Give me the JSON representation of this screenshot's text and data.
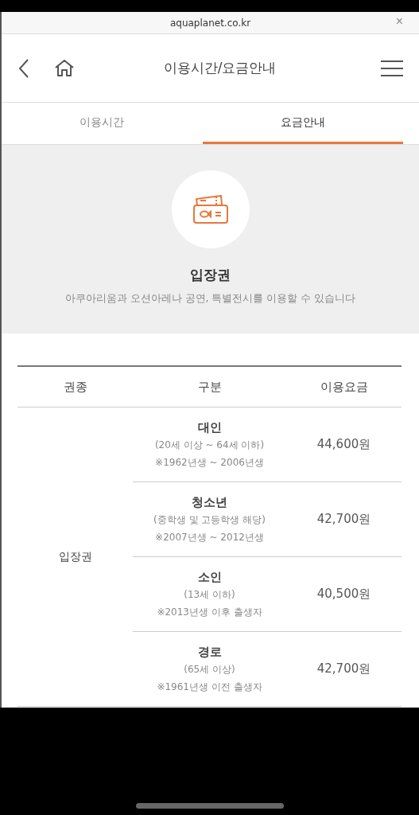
{
  "browser_bar": {
    "url": "aquaplanet.co.kr",
    "close": "×"
  },
  "header": {
    "title": "이용시간/요금안내"
  },
  "tabs": [
    {
      "label": "이용시간",
      "selected": false
    },
    {
      "label": "요금안내",
      "selected": true
    }
  ],
  "intro": {
    "title": "입장권",
    "description": "아쿠아리움과 오션아레나 공연, 특별전시를 이용할 수 있습니다"
  },
  "table": {
    "columns": [
      "권종",
      "구분",
      "이용요금"
    ],
    "group": "입장권",
    "rows": [
      {
        "name": "대인",
        "condition": "(20세 이상 ~ 64세 이하)",
        "note": "※1962년생 ~ 2006년생",
        "price": "44,600원"
      },
      {
        "name": "청소년",
        "condition": "(중학생 및 고등학생 해당)",
        "note": "※2007년생 ~ 2012년생",
        "price": "42,700원"
      },
      {
        "name": "소인",
        "condition": "(13세 이하)",
        "note": "※2013년생 이후 출생자",
        "price": "40,500원"
      },
      {
        "name": "경로",
        "condition": "(65세 이상)",
        "note": "※1961년생 이전 출생자",
        "price": "42,700원"
      }
    ]
  }
}
